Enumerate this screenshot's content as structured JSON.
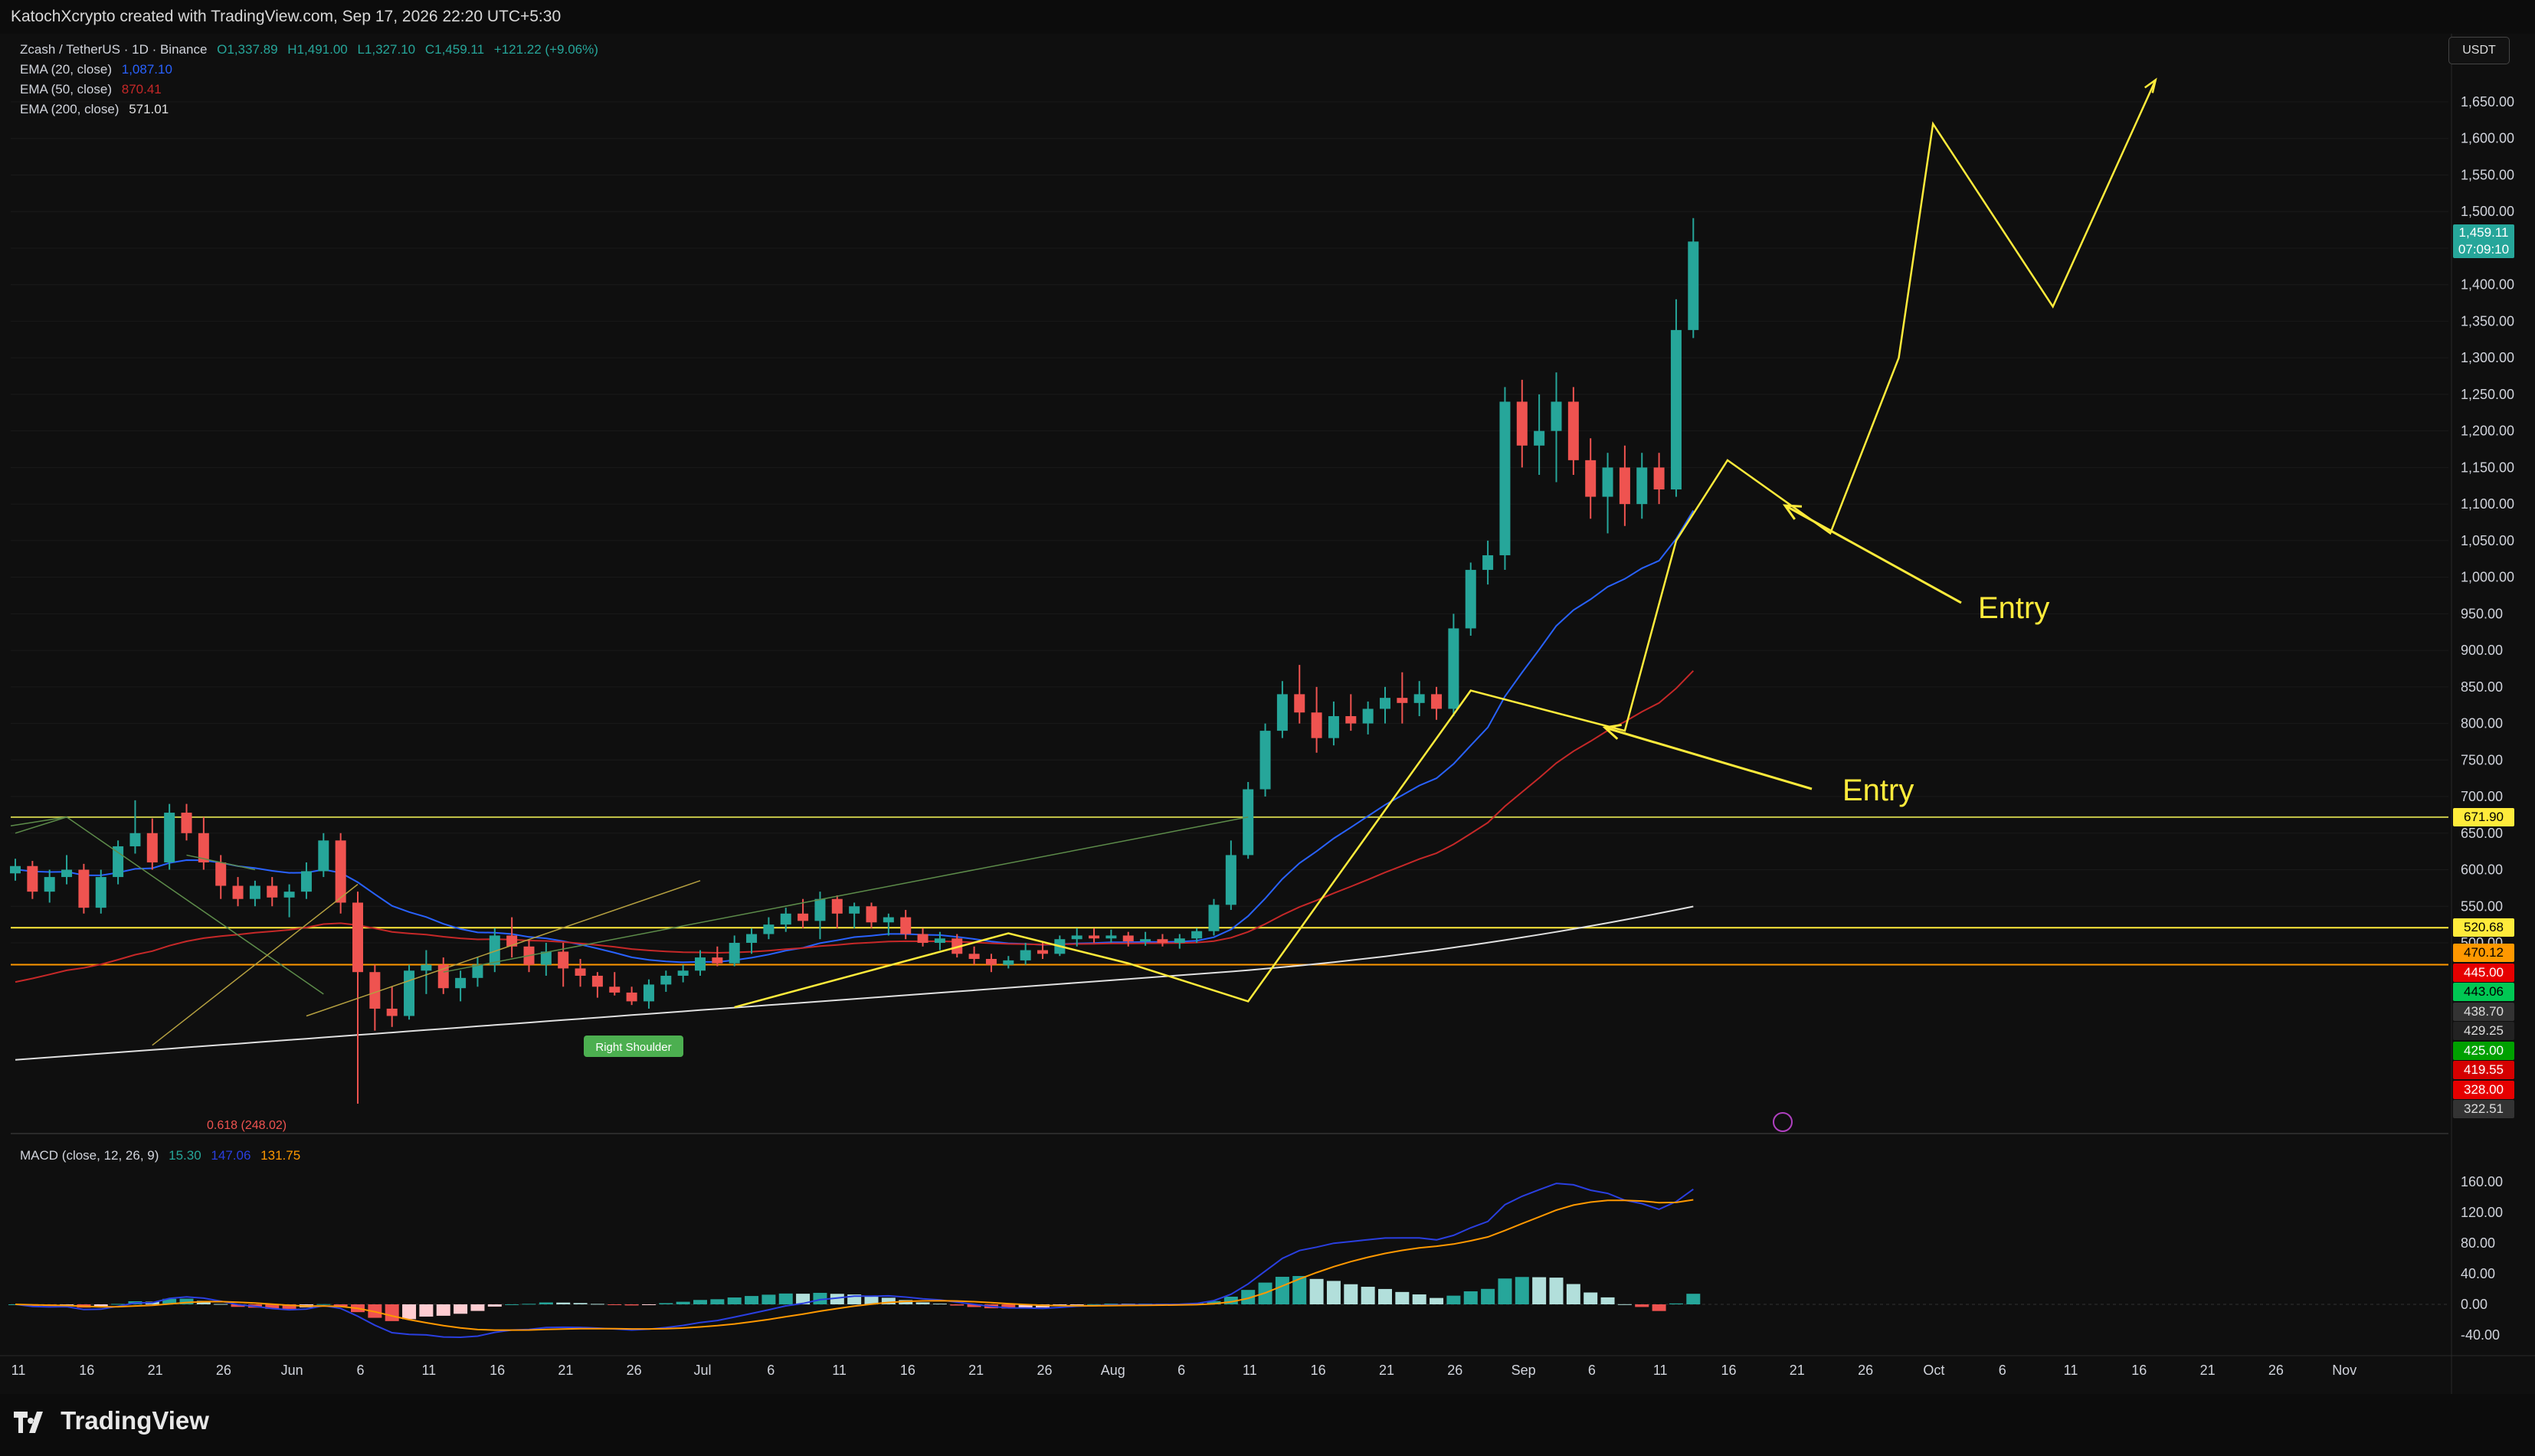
{
  "header": {
    "credit": "KatochXcrypto created with TradingView.com, Sep 17, 2026 22:20 UTC+5:30"
  },
  "legend": {
    "symbol": "Zcash / TetherUS · 1D · Binance",
    "o": "O1,337.89",
    "h": "H1,491.00",
    "l": "L1,327.10",
    "c": "C1,459.11",
    "chg": "+121.22 (+9.06%)",
    "ema20_label": "EMA (20, close)",
    "ema20_value": "1,087.10",
    "ema50_label": "EMA (50, close)",
    "ema50_value": "870.41",
    "ema200_label": "EMA (200, close)",
    "ema200_value": "571.01",
    "macd_label": "MACD (close, 12, 26, 9)",
    "macd_v1": "15.30",
    "macd_v2": "147.06",
    "macd_v3": "131.75"
  },
  "currency_button": "USDT",
  "brand": "TradingView",
  "colors": {
    "background": "#0f0f0f",
    "bull": "#26a69a",
    "bear": "#ef5350",
    "ema20": "#2962ff",
    "ema50": "#c62828",
    "ema200": "#e0e0e0",
    "drawing": "#ffeb3b",
    "macd_line": "#2a3fe0",
    "signal_line": "#ff9800"
  },
  "chart_data": {
    "type": "candlestick",
    "symbol": "ZEC/USDT",
    "interval": "1D",
    "price_axis_ticks": [
      "1,650.00",
      "1,600.00",
      "1,550.00",
      "1,500.00",
      "1,450.00",
      "1,400.00",
      "1,350.00",
      "1,300.00",
      "1,250.00",
      "1,200.00",
      "1,150.00",
      "1,100.00",
      "1,050.00",
      "1,000.00",
      "950.00",
      "900.00",
      "850.00",
      "800.00",
      "750.00",
      "700.00",
      "650.00",
      "600.00",
      "550.00",
      "500.00"
    ],
    "price_axis_values": [
      1650,
      1600,
      1550,
      1500,
      1450,
      1400,
      1350,
      1300,
      1250,
      1200,
      1150,
      1100,
      1050,
      1000,
      950,
      900,
      850,
      800,
      750,
      700,
      650,
      600,
      550,
      500
    ],
    "macd_axis_ticks": [
      "160.00",
      "120.00",
      "80.00",
      "40.00",
      "0.00",
      "-40.00"
    ],
    "macd_axis_values": [
      160,
      120,
      80,
      40,
      0,
      -40
    ],
    "time_axis_labels": [
      "11",
      "16",
      "21",
      "26",
      "Jun",
      "6",
      "11",
      "16",
      "21",
      "26",
      "Jul",
      "6",
      "11",
      "16",
      "21",
      "26",
      "Aug",
      "6",
      "11",
      "16",
      "21",
      "26",
      "Sep",
      "6",
      "11",
      "16",
      "21",
      "26",
      "Oct",
      "6",
      "11",
      "16",
      "21",
      "26",
      "Nov"
    ],
    "last_price": "1,459.11",
    "countdown": "07:09:10",
    "price_labels": [
      {
        "text": "671.90",
        "value": 671.9,
        "bg": "#ffeb3b",
        "fg": "#000"
      },
      {
        "text": "520.68",
        "value": 520.68,
        "bg": "#ffeb3b",
        "fg": "#000"
      },
      {
        "text": "470.12",
        "value": 470.12,
        "bg": "#ff9800",
        "fg": "#000"
      },
      {
        "text": "445.00",
        "value": 445,
        "bg": "#e60000",
        "fg": "#fff"
      },
      {
        "text": "443.06",
        "value": 443.06,
        "bg": "#00c853",
        "fg": "#000"
      },
      {
        "text": "438.70",
        "value": 438.7,
        "bg": "#333",
        "fg": "#ddd"
      },
      {
        "text": "429.25",
        "value": 429.25,
        "bg": "#222",
        "fg": "#ddd"
      },
      {
        "text": "425.00",
        "value": 425,
        "bg": "#00a000",
        "fg": "#fff"
      },
      {
        "text": "419.55",
        "value": 419.55,
        "bg": "#d50000",
        "fg": "#fff"
      },
      {
        "text": "328.00",
        "value": 328,
        "bg": "#e60000",
        "fg": "#fff"
      },
      {
        "text": "322.51",
        "value": 322.51,
        "bg": "#333",
        "fg": "#ddd"
      }
    ],
    "horizontal_levels": [
      {
        "value": 671.9,
        "color": "#c8c84a"
      },
      {
        "value": 520.68,
        "color": "#ffeb3b"
      },
      {
        "value": 470.12,
        "color": "#ff9800"
      }
    ],
    "annotations": {
      "entry_1": "Entry",
      "entry_2": "Entry",
      "right_shoulder": "Right Shoulder",
      "fib_label": "0.618 (248.02)"
    },
    "candles_ohlc": [
      [
        595,
        615,
        585,
        605
      ],
      [
        605,
        612,
        560,
        570
      ],
      [
        570,
        600,
        555,
        590
      ],
      [
        590,
        620,
        580,
        600
      ],
      [
        600,
        608,
        540,
        548
      ],
      [
        548,
        600,
        540,
        590
      ],
      [
        590,
        640,
        580,
        632
      ],
      [
        632,
        695,
        622,
        650
      ],
      [
        650,
        670,
        600,
        610
      ],
      [
        610,
        690,
        600,
        678
      ],
      [
        678,
        690,
        640,
        650
      ],
      [
        650,
        672,
        600,
        610
      ],
      [
        610,
        620,
        560,
        578
      ],
      [
        578,
        590,
        550,
        560
      ],
      [
        560,
        585,
        550,
        578
      ],
      [
        578,
        590,
        550,
        562
      ],
      [
        562,
        580,
        535,
        570
      ],
      [
        570,
        610,
        560,
        598
      ],
      [
        598,
        650,
        590,
        640
      ],
      [
        640,
        650,
        540,
        555
      ],
      [
        555,
        570,
        280,
        460
      ],
      [
        460,
        470,
        380,
        410
      ],
      [
        410,
        440,
        385,
        400
      ],
      [
        400,
        470,
        395,
        462
      ],
      [
        462,
        490,
        430,
        470
      ],
      [
        470,
        480,
        430,
        438
      ],
      [
        438,
        462,
        420,
        452
      ],
      [
        452,
        480,
        440,
        470
      ],
      [
        470,
        520,
        460,
        510
      ],
      [
        510,
        535,
        480,
        495
      ],
      [
        495,
        505,
        460,
        470
      ],
      [
        470,
        500,
        455,
        488
      ],
      [
        488,
        500,
        440,
        465
      ],
      [
        465,
        478,
        440,
        455
      ],
      [
        455,
        460,
        425,
        440
      ],
      [
        440,
        460,
        428,
        432
      ],
      [
        432,
        440,
        415,
        420
      ],
      [
        420,
        450,
        410,
        443
      ],
      [
        443,
        462,
        433,
        455
      ],
      [
        455,
        470,
        446,
        462
      ],
      [
        462,
        490,
        455,
        480
      ],
      [
        480,
        495,
        468,
        472
      ],
      [
        472,
        510,
        468,
        500
      ],
      [
        500,
        520,
        485,
        512
      ],
      [
        512,
        535,
        505,
        525
      ],
      [
        525,
        548,
        515,
        540
      ],
      [
        540,
        560,
        520,
        530
      ],
      [
        530,
        570,
        505,
        560
      ],
      [
        560,
        565,
        520,
        540
      ],
      [
        540,
        555,
        520,
        550
      ],
      [
        550,
        555,
        520,
        528
      ],
      [
        528,
        540,
        510,
        535
      ],
      [
        535,
        545,
        505,
        512
      ],
      [
        512,
        520,
        495,
        500
      ],
      [
        500,
        515,
        490,
        506
      ],
      [
        506,
        512,
        480,
        485
      ],
      [
        485,
        495,
        470,
        478
      ],
      [
        478,
        485,
        460,
        470
      ],
      [
        470,
        482,
        465,
        476
      ],
      [
        476,
        500,
        470,
        490
      ],
      [
        490,
        502,
        478,
        485
      ],
      [
        485,
        510,
        482,
        505
      ],
      [
        505,
        520,
        495,
        510
      ],
      [
        510,
        520,
        500,
        506
      ],
      [
        506,
        518,
        500,
        510
      ],
      [
        510,
        515,
        495,
        502
      ],
      [
        502,
        515,
        496,
        505
      ],
      [
        505,
        512,
        495,
        500
      ],
      [
        500,
        512,
        492,
        506
      ],
      [
        506,
        520,
        500,
        516
      ],
      [
        516,
        560,
        510,
        552
      ],
      [
        552,
        640,
        545,
        620
      ],
      [
        620,
        720,
        615,
        710
      ],
      [
        710,
        800,
        700,
        790
      ],
      [
        790,
        858,
        780,
        840
      ],
      [
        840,
        880,
        800,
        815
      ],
      [
        815,
        850,
        760,
        780
      ],
      [
        780,
        830,
        770,
        810
      ],
      [
        810,
        840,
        790,
        800
      ],
      [
        800,
        830,
        785,
        820
      ],
      [
        820,
        850,
        800,
        835
      ],
      [
        835,
        870,
        800,
        828
      ],
      [
        828,
        858,
        810,
        840
      ],
      [
        840,
        850,
        805,
        820
      ],
      [
        820,
        950,
        810,
        930
      ],
      [
        930,
        1020,
        920,
        1010
      ],
      [
        1010,
        1050,
        990,
        1030
      ],
      [
        1030,
        1260,
        1010,
        1240
      ],
      [
        1240,
        1270,
        1150,
        1180
      ],
      [
        1180,
        1250,
        1140,
        1200
      ],
      [
        1200,
        1280,
        1130,
        1240
      ],
      [
        1240,
        1260,
        1140,
        1160
      ],
      [
        1160,
        1190,
        1080,
        1110
      ],
      [
        1110,
        1170,
        1060,
        1150
      ],
      [
        1150,
        1180,
        1070,
        1100
      ],
      [
        1100,
        1170,
        1080,
        1150
      ],
      [
        1150,
        1170,
        1100,
        1120
      ],
      [
        1120,
        1380,
        1110,
        1338
      ],
      [
        1338,
        1491,
        1327,
        1459
      ]
    ]
  }
}
